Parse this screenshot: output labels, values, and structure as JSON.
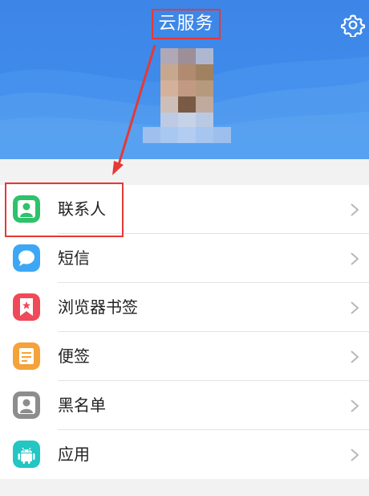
{
  "header": {
    "title": "云服务",
    "settings_icon": "gear-icon",
    "background_color": "#3f8bea"
  },
  "annotation": {
    "color": "#e53935"
  },
  "menu": {
    "items": [
      {
        "label": "联系人",
        "icon": "contacts-icon",
        "color": "#2dc26b"
      },
      {
        "label": "短信",
        "icon": "message-icon",
        "color": "#3da7f5"
      },
      {
        "label": "浏览器书签",
        "icon": "bookmark-icon",
        "color": "#f0495a"
      },
      {
        "label": "便签",
        "icon": "note-icon",
        "color": "#f5a23a"
      },
      {
        "label": "黑名单",
        "icon": "blacklist-icon",
        "color": "#8d8d8d"
      },
      {
        "label": "应用",
        "icon": "android-icon",
        "color": "#23c6c2"
      }
    ]
  }
}
